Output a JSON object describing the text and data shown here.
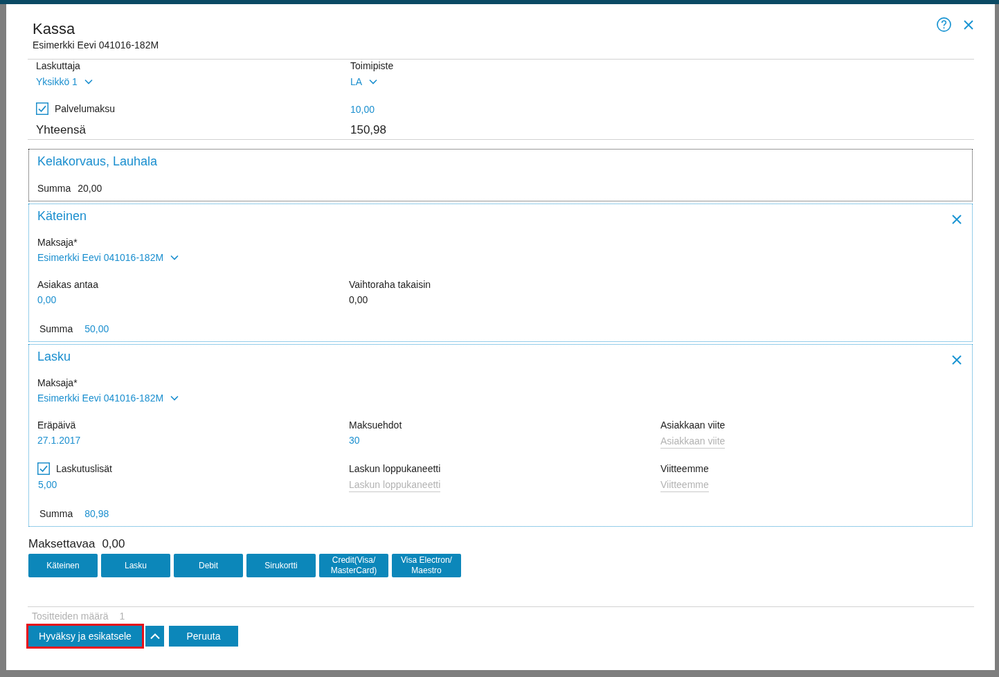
{
  "dialog": {
    "title": "Kassa",
    "subtitle": "Esimerkki Eevi 041016-182M"
  },
  "header_fields": [
    {
      "label": "Laskuttaja",
      "value": "Yksikkö 1"
    },
    {
      "label": "Toimipiste",
      "value": "LA"
    }
  ],
  "service_fee": {
    "label": "Palvelumaksu",
    "checked": true,
    "value": "10,00"
  },
  "total": {
    "label": "Yhteensä",
    "value": "150,98"
  },
  "sections": [
    {
      "title": "Kelakorvaus, Lauhala",
      "focused": true,
      "removable": false,
      "sum_label": "Summa",
      "sum": "20,00",
      "sum_editable": false
    },
    {
      "title": "Käteinen",
      "focused": false,
      "removable": true,
      "payer": {
        "label": "Maksaja*",
        "value": "Esimerkki Eevi 041016-182M"
      },
      "field_rows": [
        [
          {
            "kind": "edit",
            "label": "Asiakas antaa",
            "value": "0,00"
          },
          {
            "kind": "static",
            "label": "Vaihtoraha takaisin",
            "value": "0,00"
          }
        ]
      ],
      "sum_label": "Summa",
      "sum": "50,00",
      "sum_editable": true
    },
    {
      "title": "Lasku",
      "focused": false,
      "removable": true,
      "payer": {
        "label": "Maksaja*",
        "value": "Esimerkki Eevi 041016-182M"
      },
      "field_rows": [
        [
          {
            "kind": "edit",
            "label": "Eräpäivä",
            "value": "27.1.2017"
          },
          {
            "kind": "edit",
            "label": "Maksuehdot",
            "value": "30"
          },
          {
            "kind": "input",
            "label": "Asiakkaan viite",
            "placeholder": "Asiakkaan viite"
          }
        ],
        [
          {
            "kind": "checkbox",
            "label": "Laskutuslisät",
            "checked": true,
            "value": "5,00"
          },
          {
            "kind": "input",
            "label": "Laskun loppukaneetti",
            "placeholder": "Laskun loppukaneetti"
          },
          {
            "kind": "input",
            "label": "Viitteemme",
            "placeholder": "Viitteemme"
          }
        ]
      ],
      "sum_label": "Summa",
      "sum": "80,98",
      "sum_editable": true
    }
  ],
  "amount_due": {
    "label": "Maksettavaa",
    "value": "0,00"
  },
  "payment_buttons": [
    "Käteinen",
    "Lasku",
    "Debit",
    "Sirukortti",
    "Credit(Visa/\nMasterCard)",
    "Visa Electron/\nMaestro"
  ],
  "footer": {
    "count_label": "Tositteiden määrä",
    "count": "1",
    "buttons": [
      {
        "kind": "primary",
        "label": "Hyväksy ja esikatsele",
        "highlighted": true
      },
      {
        "kind": "menu",
        "highlighted": false
      },
      {
        "kind": "secondary",
        "label": "Peruuta",
        "highlighted": false
      }
    ]
  }
}
